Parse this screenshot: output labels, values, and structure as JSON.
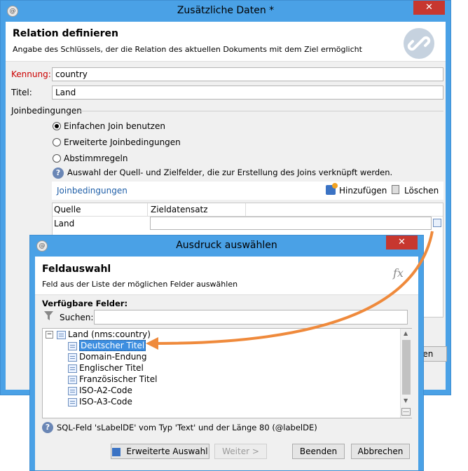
{
  "back_window": {
    "title": "Zusätzliche Daten *",
    "header_title": "Relation definieren",
    "header_subtitle": "Angabe des Schlüssels, der die Relation des aktuellen Dokuments mit dem Ziel ermöglicht",
    "kennung_label": "Kennung:",
    "kennung_value": "country",
    "titel_label": "Titel:",
    "titel_value": "Land",
    "join_section": "Joinbedingungen",
    "radio_simple": "Einfachen Join benutzen",
    "radio_extended": "Erweiterte Joinbedingungen",
    "radio_reconcile": "Abstimmregeln",
    "help_text": "Auswahl der Quell- und Zielfelder, die zur Erstellung des Joins verknüpft werden.",
    "join_tab": "Joinbedingungen",
    "add_label": "Hinzufügen",
    "delete_label": "Löschen",
    "col_source": "Quelle",
    "col_target": "Zieldatensatz",
    "row_source": "Land",
    "row_target": "",
    "partial_button": "len"
  },
  "front_window": {
    "title": "Ausdruck auswählen",
    "header_title": "Feldauswahl",
    "header_subtitle": "Feld aus der Liste der möglichen Felder auswählen",
    "fx": "fx",
    "available_label": "Verfügbare Felder:",
    "search_label": "Suchen:",
    "search_value": "",
    "tree_root": "Land (nms:country)",
    "tree_items": [
      "Deutscher Titel",
      "Domain-Endung",
      "Englischer Titel",
      "Französischer Titel",
      "ISO-A2-Code",
      "ISO-A3-Code"
    ],
    "selected_index": 0,
    "status_text": "SQL-Feld 'sLabelDE' vom Typ 'Text' und der Länge 80 (@labelDE)",
    "btn_advanced": "Erweiterte Auswahl",
    "btn_next": "Weiter >",
    "btn_finish": "Beenden",
    "btn_cancel": "Abbrechen"
  },
  "colors": {
    "accent": "#4aa1e6",
    "arrow": "#ef8a3c",
    "kennung_label": "#cc0000",
    "selection": "#3d8ee0"
  }
}
